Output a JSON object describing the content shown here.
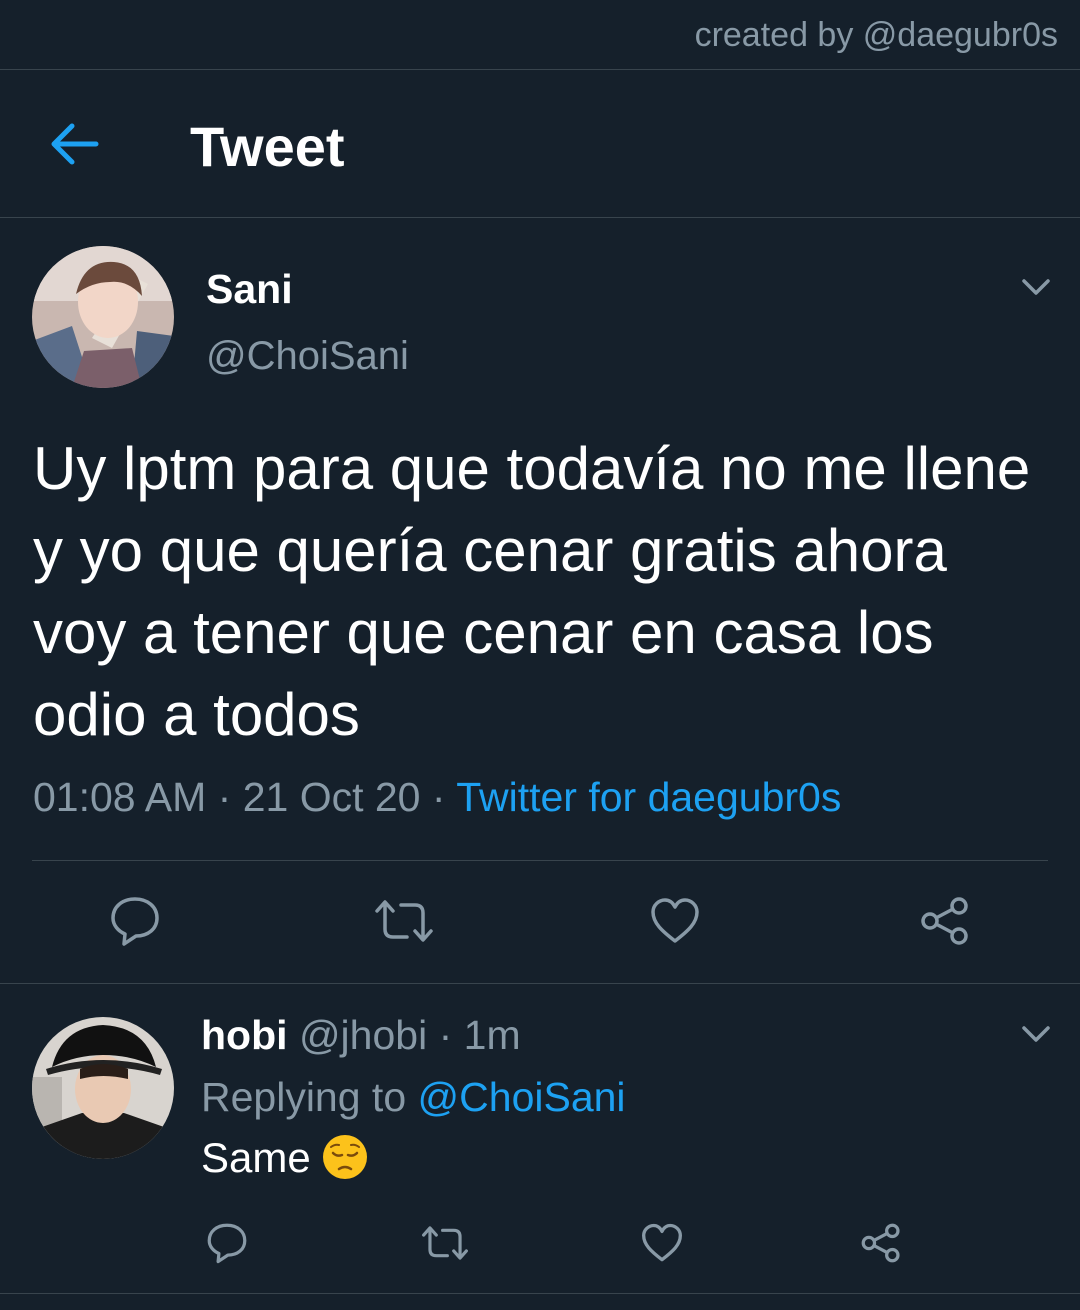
{
  "watermark": "created by @daegubr0s",
  "header": {
    "title": "Tweet",
    "back_icon": "arrow-left-icon"
  },
  "tweet": {
    "name": "Sani",
    "handle": "@ChoiSani",
    "text": "Uy lptm para que todavía no me llene y yo que quería cenar gratis ahora voy a tener que cenar en casa los odio a todos",
    "time": "01:08 AM",
    "date": "21 Oct 20",
    "client": "Twitter for daegubr0s",
    "separator": "·"
  },
  "reply": {
    "name": "hobi",
    "handle": "@jhobi",
    "age": "1m",
    "replying_label": "Replying to",
    "replying_to": "@ChoiSani",
    "text": "Same",
    "emoji": "pensive-face"
  },
  "colors": {
    "background": "#15202b",
    "accent": "#1da1f2",
    "muted": "#8899a6",
    "divider": "#38444d"
  }
}
